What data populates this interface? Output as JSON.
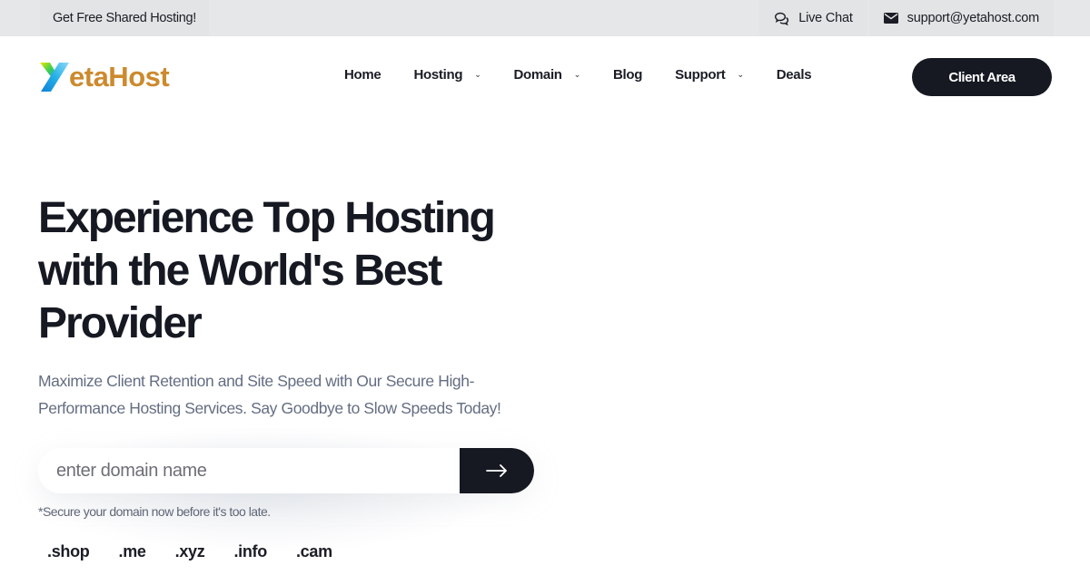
{
  "topbar": {
    "promo": "Get Free Shared Hosting!",
    "live_chat": "Live Chat",
    "email": "support@yetahost.com",
    "icons": {
      "chat": "chat-bubbles-icon",
      "email": "envelope-icon"
    }
  },
  "header": {
    "logo_text": "etaHost",
    "logo_mark": "Y",
    "brand_color": "#cc8a2e",
    "nav": [
      {
        "label": "Home",
        "dropdown": false
      },
      {
        "label": "Hosting",
        "dropdown": true
      },
      {
        "label": "Domain",
        "dropdown": true
      },
      {
        "label": "Blog",
        "dropdown": false
      },
      {
        "label": "Support",
        "dropdown": true
      },
      {
        "label": "Deals",
        "dropdown": false
      }
    ],
    "client_area": "Client Area"
  },
  "hero": {
    "title": "Experience Top Hosting with the World's Best Provider",
    "subtitle": "Maximize Client Retention and Site Speed with Our Secure High-Performance Hosting Services. Say Goodbye to Slow Speeds Today!",
    "search": {
      "placeholder": "enter domain name",
      "value": "",
      "button_icon": "arrow-right-icon"
    },
    "note": "*Secure your domain now before it's too late.",
    "tlds": [
      ".shop",
      ".me",
      ".xyz",
      ".info",
      ".cam"
    ]
  }
}
